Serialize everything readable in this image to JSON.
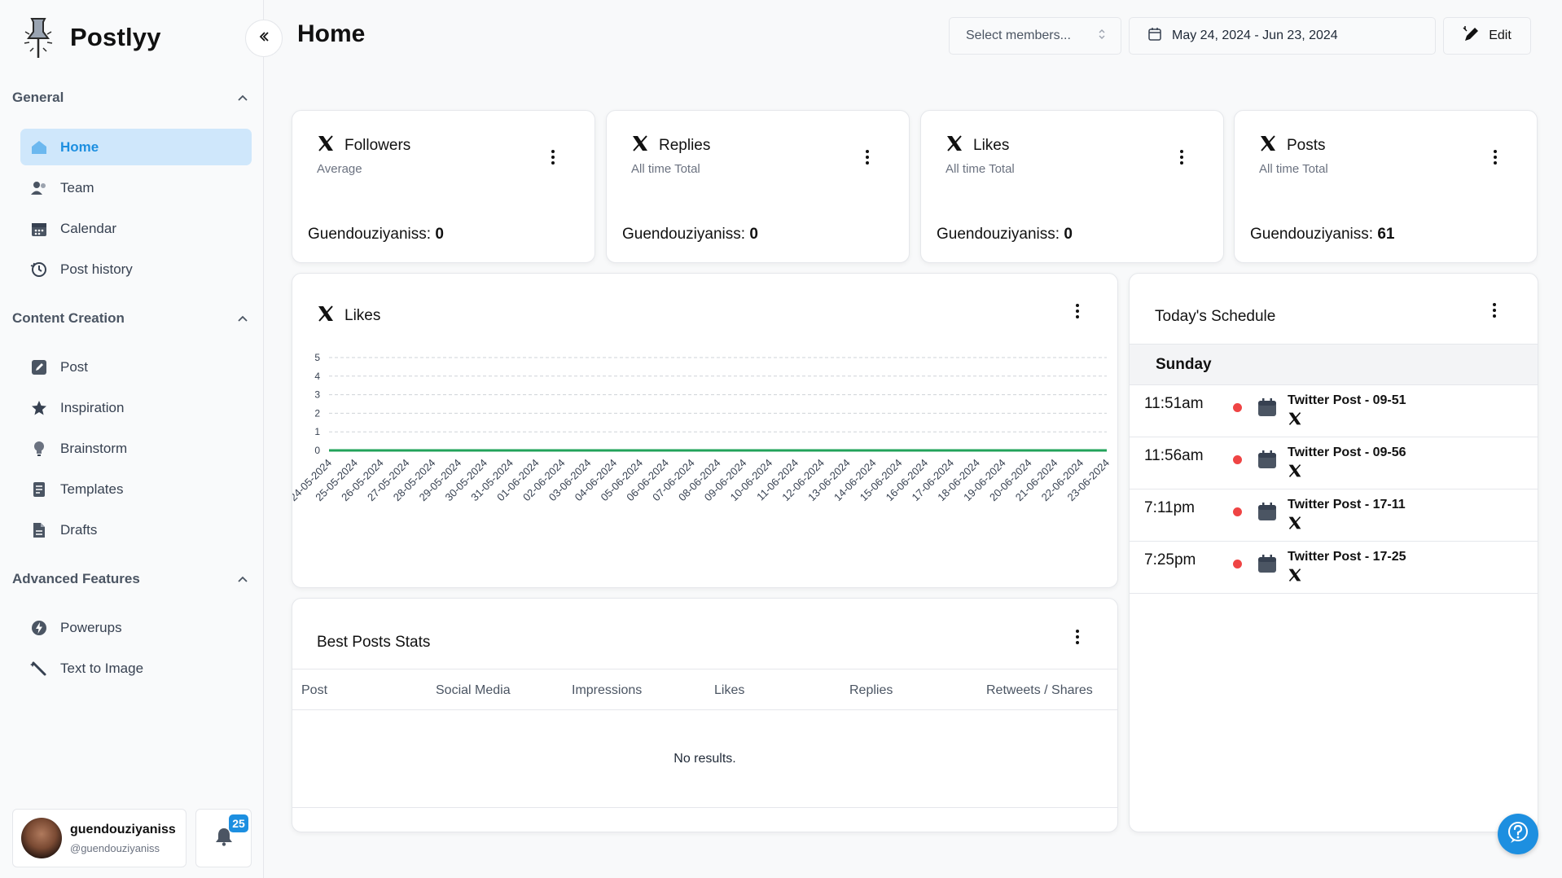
{
  "app": {
    "name": "Postlyy"
  },
  "header": {
    "title": "Home",
    "members_placeholder": "Select members...",
    "date_range": "May 24, 2024 - Jun 23, 2024",
    "edit_label": "Edit"
  },
  "sidebar": {
    "sections": [
      {
        "title": "General",
        "items": [
          {
            "label": "Home",
            "icon": "home-icon",
            "active": true
          },
          {
            "label": "Team",
            "icon": "team-icon"
          },
          {
            "label": "Calendar",
            "icon": "calendar-icon"
          },
          {
            "label": "Post history",
            "icon": "history-icon"
          }
        ]
      },
      {
        "title": "Content Creation",
        "items": [
          {
            "label": "Post",
            "icon": "pencil-icon"
          },
          {
            "label": "Inspiration",
            "icon": "star-icon"
          },
          {
            "label": "Brainstorm",
            "icon": "lightbulb-icon"
          },
          {
            "label": "Templates",
            "icon": "template-icon"
          },
          {
            "label": "Drafts",
            "icon": "draft-icon"
          }
        ]
      },
      {
        "title": "Advanced Features",
        "items": [
          {
            "label": "Powerups",
            "icon": "bolt-icon"
          },
          {
            "label": "Text to Image",
            "icon": "magic-wand-icon"
          }
        ]
      }
    ]
  },
  "user": {
    "name": "guendouziyaniss",
    "handle": "@guendouziyaniss",
    "notifications": "25"
  },
  "stats": [
    {
      "title": "Followers",
      "subtitle": "Average",
      "account": "Guendouziyaniss:",
      "value": "0"
    },
    {
      "title": "Replies",
      "subtitle": "All time Total",
      "account": "Guendouziyaniss:",
      "value": "0"
    },
    {
      "title": "Likes",
      "subtitle": "All time Total",
      "account": "Guendouziyaniss:",
      "value": "0"
    },
    {
      "title": "Posts",
      "subtitle": "All time Total",
      "account": "Guendouziyaniss:",
      "value": "61"
    }
  ],
  "likes_chart": {
    "title": "Likes"
  },
  "chart_data": {
    "type": "line",
    "title": "Likes",
    "categories": [
      "24-05-2024",
      "25-05-2024",
      "26-05-2024",
      "27-05-2024",
      "28-05-2024",
      "29-05-2024",
      "30-05-2024",
      "31-05-2024",
      "01-06-2024",
      "02-06-2024",
      "03-06-2024",
      "04-06-2024",
      "05-06-2024",
      "06-06-2024",
      "07-06-2024",
      "08-06-2024",
      "09-06-2024",
      "10-06-2024",
      "11-06-2024",
      "12-06-2024",
      "13-06-2024",
      "14-06-2024",
      "15-06-2024",
      "16-06-2024",
      "17-06-2024",
      "18-06-2024",
      "19-06-2024",
      "20-06-2024",
      "21-06-2024",
      "22-06-2024",
      "23-06-2024"
    ],
    "series": [
      {
        "values": [
          0,
          0,
          0,
          0,
          0,
          0,
          0,
          0,
          0,
          0,
          0,
          0,
          0,
          0,
          0,
          0,
          0,
          0,
          0,
          0,
          0,
          0,
          0,
          0,
          0,
          0,
          0,
          0,
          0,
          0,
          0
        ],
        "color": "#22a35a"
      }
    ],
    "yticks": [
      0,
      1,
      2,
      3,
      4,
      5
    ],
    "ylim": [
      0,
      5
    ],
    "grid": true,
    "xlabel": "",
    "ylabel": ""
  },
  "best_posts": {
    "title": "Best Posts Stats",
    "columns": [
      "Post",
      "Social Media",
      "Impressions",
      "Likes",
      "Replies",
      "Retweets / Shares"
    ],
    "empty": "No results."
  },
  "schedule": {
    "title": "Today's Schedule",
    "day": "Sunday",
    "items": [
      {
        "time": "11:51am",
        "post": "Twitter Post - 09-51"
      },
      {
        "time": "11:56am",
        "post": "Twitter Post - 09-56"
      },
      {
        "time": "7:11pm",
        "post": "Twitter Post - 17-11"
      },
      {
        "time": "7:25pm",
        "post": "Twitter Post - 17-25"
      }
    ]
  },
  "colors": {
    "accent": "#1d8fe0",
    "active_bg": "#cfe7fb",
    "status_red": "#ef4444",
    "line_green": "#22a35a"
  }
}
